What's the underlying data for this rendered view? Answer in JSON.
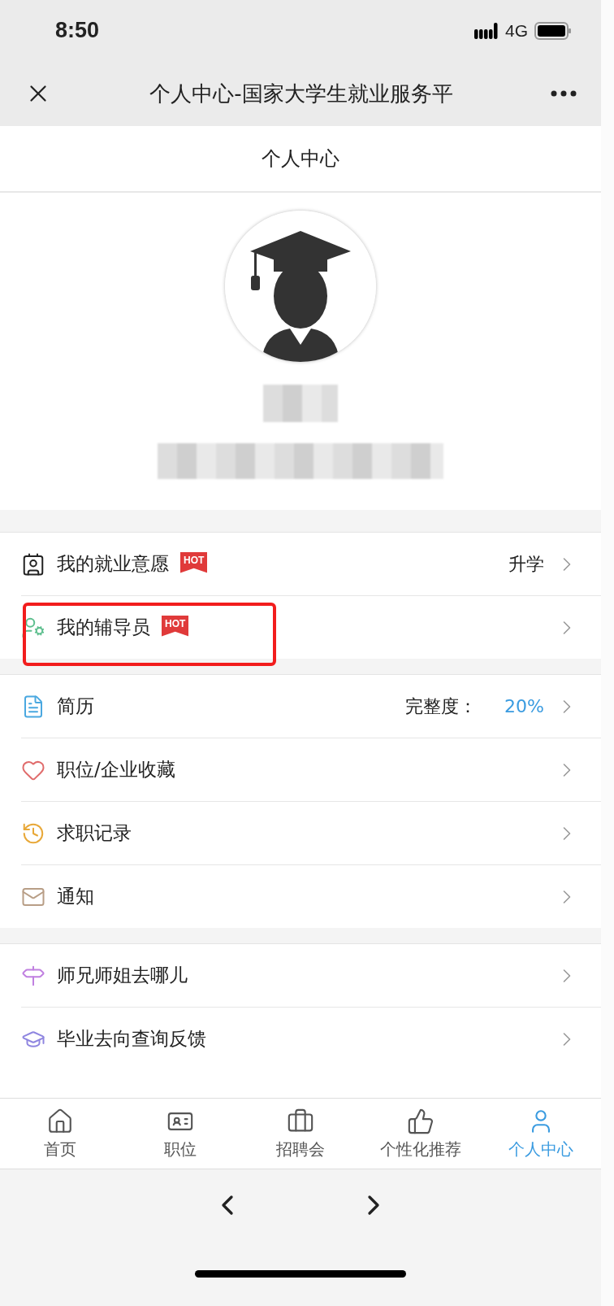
{
  "status_bar": {
    "time": "8:50",
    "network": "4G"
  },
  "browser_bar": {
    "title": "个人中心-国家大学生就业服务平"
  },
  "header": {
    "title": "个人中心"
  },
  "sections": [
    {
      "rows": [
        {
          "label": "我的就业意愿",
          "hot": true,
          "hot_text": "HOT",
          "value": "升学",
          "highlighted": false
        },
        {
          "label": "我的辅导员",
          "hot": true,
          "hot_text": "HOT",
          "highlighted": true
        }
      ]
    },
    {
      "rows": [
        {
          "label": "简历",
          "hot": false,
          "value_label": "完整度：",
          "value": "20%",
          "highlighted": false
        },
        {
          "label": "职位/企业收藏",
          "hot": false,
          "highlighted": false
        },
        {
          "label": "求职记录",
          "hot": false,
          "highlighted": false
        },
        {
          "label": "通知",
          "hot": false,
          "highlighted": false
        }
      ]
    },
    {
      "rows": [
        {
          "label": "师兄师姐去哪儿",
          "hot": false,
          "highlighted": false
        },
        {
          "label": "毕业去向查询反馈",
          "hot": false,
          "highlighted": false
        }
      ]
    }
  ],
  "tabs": [
    {
      "label": "首页",
      "selected": false
    },
    {
      "label": "职位",
      "selected": false
    },
    {
      "label": "招聘会",
      "selected": false
    },
    {
      "label": "个性化推荐",
      "selected": false
    },
    {
      "label": "个人中心",
      "selected": true
    }
  ]
}
